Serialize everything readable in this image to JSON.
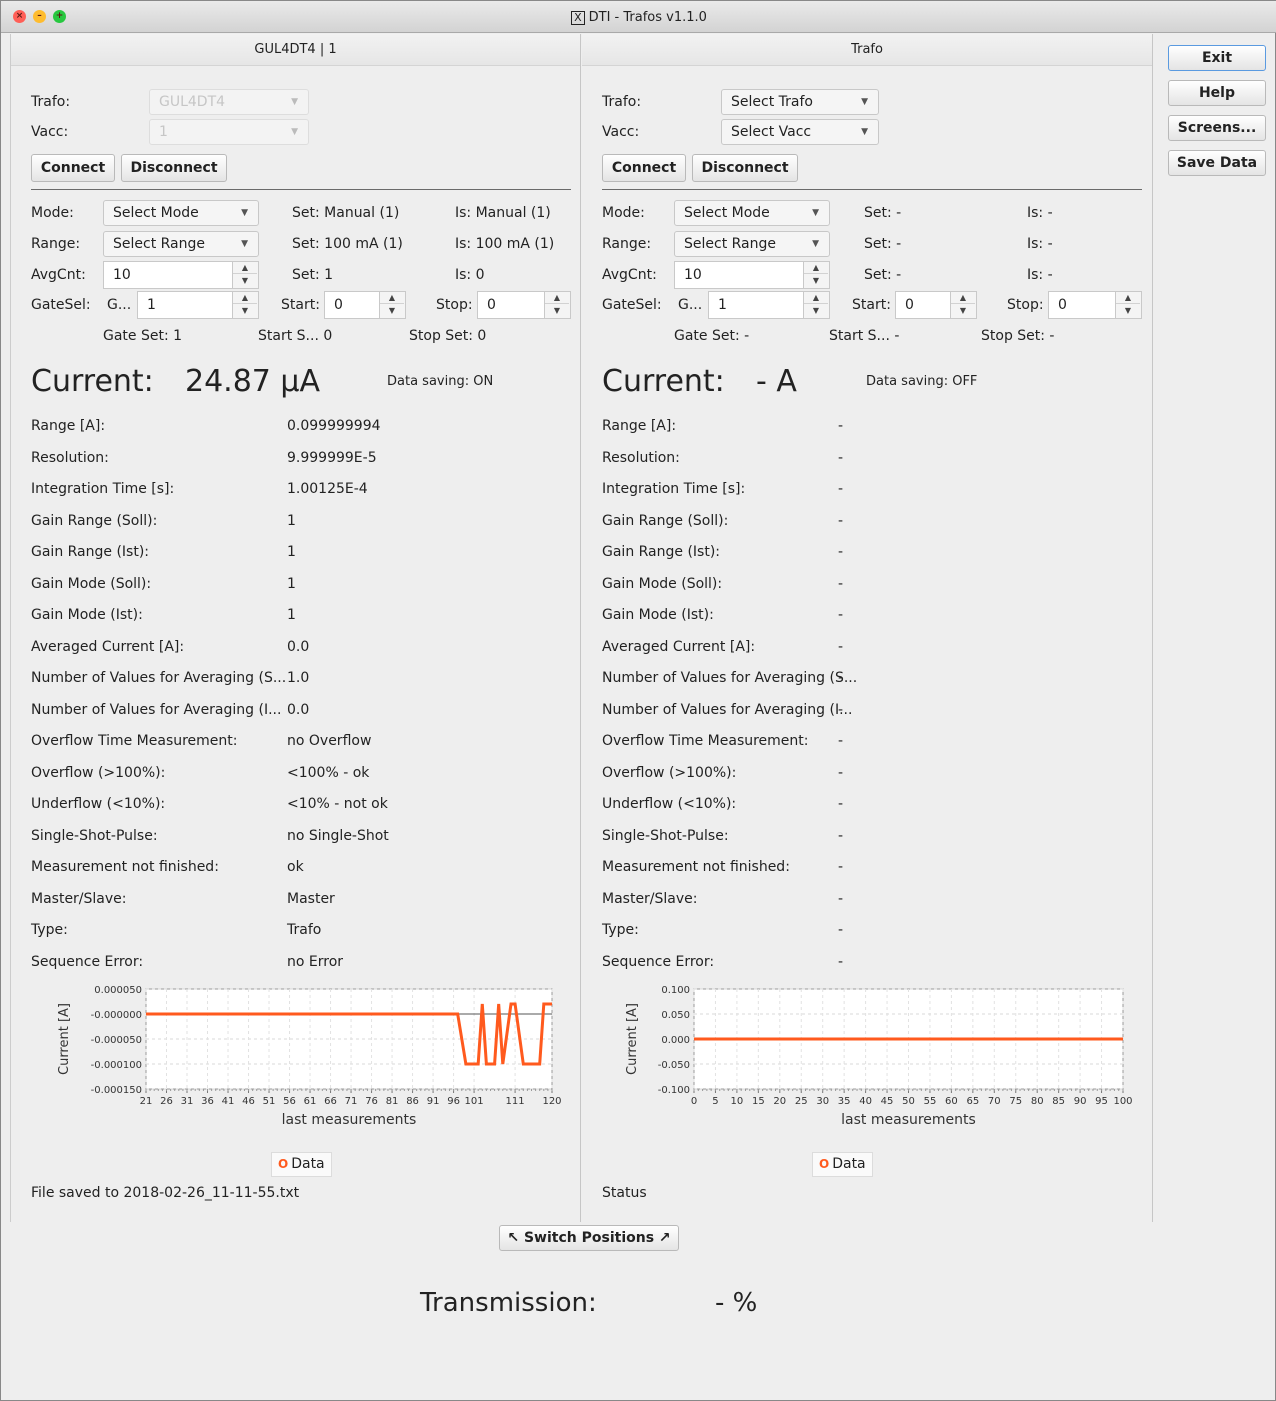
{
  "window": {
    "title": "DTI - Trafos v1.1.0",
    "x_glyph": "X"
  },
  "side": {
    "exit": "Exit",
    "help": "Help",
    "screens": "Screens...",
    "save": "Save Data"
  },
  "left": {
    "header": "GUL4DT4 | 1",
    "trafo_label": "Trafo:",
    "trafo_value": "GUL4DT4",
    "vacc_label": "Vacc:",
    "vacc_value": "1",
    "connect": "Connect",
    "disconnect": "Disconnect",
    "mode_label": "Mode:",
    "mode_value": "Select Mode",
    "mode_set": "Set: Manual (1)",
    "mode_is": "Is: Manual (1)",
    "range_label": "Range:",
    "range_value": "Select Range",
    "range_set": "Set: 100 mA (1)",
    "range_is": "Is: 100 mA (1)",
    "avg_label": "AvgCnt:",
    "avg_value": "10",
    "avg_set": "Set: 1",
    "avg_is": "Is: 0",
    "gate_label": "GateSel:",
    "gate_short": "G...",
    "gate_value": "1",
    "start_label": "Start:",
    "start_value": "0",
    "stop_label": "Stop:",
    "stop_value": "0",
    "gate_set": "Gate Set: 1",
    "start_set": "Start S... 0",
    "stop_set": "Stop Set: 0",
    "current_label": "Current:",
    "current_value": "24.87 µA",
    "data_saving": "Data saving: ON",
    "props": [
      {
        "k": "Range [A]:",
        "v": "0.099999994"
      },
      {
        "k": "Resolution:",
        "v": "9.999999E-5"
      },
      {
        "k": "Integration Time [s]:",
        "v": "1.00125E-4"
      },
      {
        "k": "Gain Range (Soll):",
        "v": "1"
      },
      {
        "k": "Gain Range (Ist):",
        "v": "1"
      },
      {
        "k": "Gain Mode (Soll):",
        "v": "1"
      },
      {
        "k": "Gain Mode (Ist):",
        "v": "1"
      },
      {
        "k": "Averaged Current [A]:",
        "v": "0.0"
      },
      {
        "k": "Number of Values for Averaging (S...",
        "v": "1.0"
      },
      {
        "k": "Number of Values for Averaging (I...",
        "v": "0.0"
      },
      {
        "k": "Overflow Time Measurement:",
        "v": "no Overflow"
      },
      {
        "k": "Overflow (>100%):",
        "v": "<100% - ok"
      },
      {
        "k": "Underflow (<10%):",
        "v": "<10% - not ok"
      },
      {
        "k": "Single-Shot-Pulse:",
        "v": "no Single-Shot"
      },
      {
        "k": "Measurement not finished:",
        "v": "ok"
      },
      {
        "k": "Master/Slave:",
        "v": "Master"
      },
      {
        "k": "Type:",
        "v": "Trafo"
      },
      {
        "k": "Sequence Error:",
        "v": "no Error"
      }
    ],
    "legend": "Data",
    "status": "File saved to 2018-02-26_11-11-55.txt"
  },
  "right": {
    "header": "Trafo",
    "trafo_label": "Trafo:",
    "trafo_value": "Select Trafo",
    "vacc_label": "Vacc:",
    "vacc_value": "Select Vacc",
    "connect": "Connect",
    "disconnect": "Disconnect",
    "mode_label": "Mode:",
    "mode_value": "Select Mode",
    "mode_set": "Set: -",
    "mode_is": "Is: -",
    "range_label": "Range:",
    "range_value": "Select Range",
    "range_set": "Set: -",
    "range_is": "Is: -",
    "avg_label": "AvgCnt:",
    "avg_value": "10",
    "avg_set": "Set: -",
    "avg_is": "Is: -",
    "gate_label": "GateSel:",
    "gate_short": "G...",
    "gate_value": "1",
    "start_label": "Start:",
    "start_value": "0",
    "stop_label": "Stop:",
    "stop_value": "0",
    "gate_set": "Gate Set: -",
    "start_set": "Start S... -",
    "stop_set": "Stop Set: -",
    "current_label": "Current:",
    "current_value": "- A",
    "data_saving": "Data saving: OFF",
    "props": [
      {
        "k": "Range [A]:",
        "v": "-"
      },
      {
        "k": "Resolution:",
        "v": "-"
      },
      {
        "k": "Integration Time [s]:",
        "v": "-"
      },
      {
        "k": "Gain Range (Soll):",
        "v": "-"
      },
      {
        "k": "Gain Range (Ist):",
        "v": "-"
      },
      {
        "k": "Gain Mode (Soll):",
        "v": "-"
      },
      {
        "k": "Gain Mode (Ist):",
        "v": "-"
      },
      {
        "k": "Averaged Current [A]:",
        "v": "-"
      },
      {
        "k": "Number of Values for Averaging (S...",
        "v": "-"
      },
      {
        "k": "Number of Values for Averaging (I...",
        "v": "-"
      },
      {
        "k": "Overflow Time Measurement:",
        "v": "-"
      },
      {
        "k": "Overflow (>100%):",
        "v": "-"
      },
      {
        "k": "Underflow (<10%):",
        "v": "-"
      },
      {
        "k": "Single-Shot-Pulse:",
        "v": "-"
      },
      {
        "k": "Measurement not finished:",
        "v": "-"
      },
      {
        "k": "Master/Slave:",
        "v": "-"
      },
      {
        "k": "Type:",
        "v": "-"
      },
      {
        "k": "Sequence Error:",
        "v": "-"
      }
    ],
    "legend": "Data",
    "status": "Status"
  },
  "switch_positions": "↖ Switch Positions ↗",
  "transmission_label": "Transmission:",
  "transmission_value": "- %",
  "chart_data": [
    {
      "type": "line",
      "ylabel": "Current [A]",
      "xlabel": "last measurements",
      "ylim": [
        -0.00015,
        5e-05
      ],
      "xlim": [
        21,
        120
      ],
      "yticks": [
        "0.000050",
        "-0.000000",
        "-0.000050",
        "-0.000100",
        "-0.000150"
      ],
      "xticks": [
        "21",
        "26",
        "31",
        "36",
        "41",
        "46",
        "51",
        "56",
        "61",
        "66",
        "71",
        "76",
        "81",
        "86",
        "91",
        "96",
        "101",
        "111",
        "120"
      ],
      "series": [
        {
          "color": "#ff5a1e",
          "x": [
            21,
            96,
            97,
            99,
            100,
            102,
            103,
            104,
            106,
            107,
            108,
            110,
            111,
            113,
            114,
            117,
            118,
            120
          ],
          "y": [
            0.0,
            0.0,
            0.0,
            -0.0001,
            -0.0001,
            -0.0001,
            2e-05,
            -0.0001,
            -0.0001,
            2e-05,
            -0.0001,
            2e-05,
            2e-05,
            -0.0001,
            -0.0001,
            -0.0001,
            2e-05,
            2e-05
          ]
        }
      ],
      "legend": [
        "Data"
      ]
    },
    {
      "type": "line",
      "ylabel": "Current [A]",
      "xlabel": "last measurements",
      "ylim": [
        -0.1,
        0.1
      ],
      "xlim": [
        0,
        100
      ],
      "yticks": [
        "0.100",
        "0.050",
        "0.000",
        "-0.050",
        "-0.100"
      ],
      "xticks": [
        "0",
        "5",
        "10",
        "15",
        "20",
        "25",
        "30",
        "35",
        "40",
        "45",
        "50",
        "55",
        "60",
        "65",
        "70",
        "75",
        "80",
        "85",
        "90",
        "95",
        "100"
      ],
      "series": [
        {
          "color": "#ff5a1e",
          "x": [
            0,
            100
          ],
          "y": [
            0,
            0
          ]
        }
      ],
      "legend": [
        "Data"
      ]
    }
  ]
}
